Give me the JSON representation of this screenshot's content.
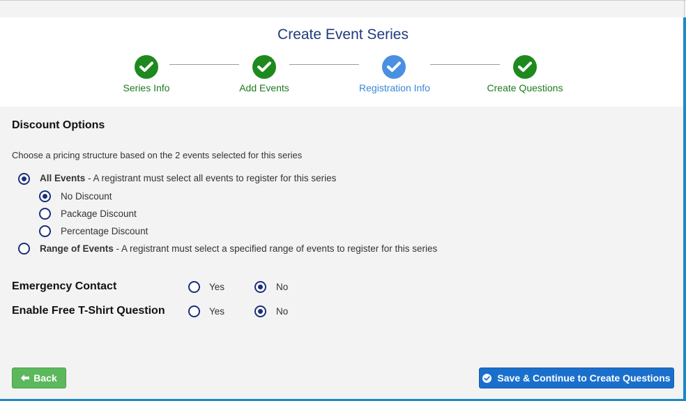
{
  "header": {
    "title": "Create Event Series"
  },
  "steps": [
    {
      "label": "Series Info",
      "icon": "check-icon",
      "state": "done"
    },
    {
      "label": "Add Events",
      "icon": "check-icon",
      "state": "done"
    },
    {
      "label": "Registration Info",
      "icon": "check-icon",
      "state": "active"
    },
    {
      "label": "Create Questions",
      "icon": "check-icon",
      "state": "done"
    }
  ],
  "discount": {
    "title": "Discount Options",
    "description": "Choose a pricing structure based on the 2 events selected for this series",
    "all_events": {
      "name": "All Events",
      "text": " - A registrant must select all events to register for this series",
      "checked": true
    },
    "sub_options": [
      {
        "label": "No Discount",
        "checked": true
      },
      {
        "label": "Package Discount",
        "checked": false
      },
      {
        "label": "Percentage Discount",
        "checked": false
      }
    ],
    "range_events": {
      "name": "Range of Events",
      "text": " - A registrant must select a specified range of events to register for this series",
      "checked": false
    }
  },
  "emergency_contact": {
    "label": "Emergency Contact",
    "yes": "Yes",
    "no": "No",
    "value": "No"
  },
  "tshirt": {
    "label": "Enable Free T-Shirt Question",
    "yes": "Yes",
    "no": "No",
    "value": "No"
  },
  "buttons": {
    "back": "Back",
    "save": "Save & Continue to Create Questions"
  },
  "colors": {
    "done": "#1e8a1e",
    "active": "#4a90e2",
    "radio": "#1a2f7a",
    "back": "#5cb85c",
    "save": "#1a6fcc"
  }
}
